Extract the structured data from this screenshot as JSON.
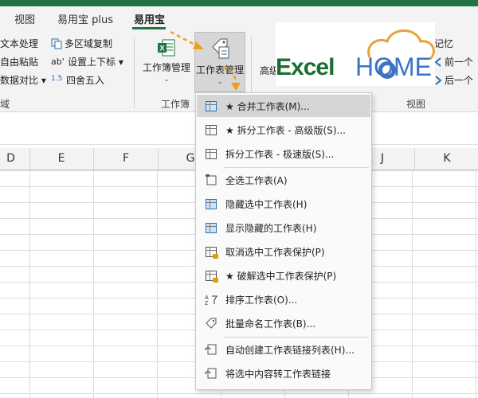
{
  "tabs": [
    {
      "label": "视图"
    },
    {
      "label": "易用宝 plus"
    },
    {
      "label": "易用宝",
      "active": true
    }
  ],
  "ribbon": {
    "left_group": {
      "items": [
        "文本处理",
        "自由粘贴",
        "数据对比 ▾"
      ],
      "label": "域"
    },
    "mid_small": {
      "items": [
        "多区域复制",
        "设置上下标 ▾",
        "四舍五入"
      ]
    },
    "workbook_btn": {
      "label": "工作簿管理",
      "caret": "⌄"
    },
    "sheet_btn": {
      "label": "工作表管理",
      "caret": "⌄"
    },
    "group_label_workbook": "工作簿",
    "partial_btn": "高级",
    "right_items": [
      "记忆",
      "前一个",
      "后一个"
    ],
    "view_group_label": "视图"
  },
  "logo": {
    "part1": "Excel",
    "part2": "HOME"
  },
  "columns": [
    "D",
    "E",
    "F",
    "G",
    "J",
    "K"
  ],
  "menu": {
    "items": [
      {
        "label": "★ 合并工作表(M)...",
        "icon": "merge-sheet-icon",
        "hover": true
      },
      {
        "label": "★ 拆分工作表 - 高级版(S)...",
        "icon": "split-sheet-icon"
      },
      {
        "label": "拆分工作表 - 极速版(S)...",
        "icon": "split-sheet-fast-icon"
      },
      {
        "label": "全选工作表(A)",
        "icon": "select-all-sheets-icon"
      },
      {
        "label": "隐藏选中工作表(H)",
        "icon": "hide-sheet-icon"
      },
      {
        "label": "显示隐藏的工作表(H)",
        "icon": "show-hidden-sheet-icon"
      },
      {
        "label": "取消选中工作表保护(P)",
        "icon": "unprotect-sheet-icon"
      },
      {
        "label": "★ 破解选中工作表保护(P)",
        "icon": "crack-protection-icon"
      },
      {
        "label": "排序工作表(O)...",
        "icon": "sort-sheets-icon"
      },
      {
        "label": "批量命名工作表(B)...",
        "icon": "rename-sheets-icon"
      },
      {
        "label": "自动创建工作表链接列表(H)...",
        "icon": "create-links-icon"
      },
      {
        "label": "将选中内容转工作表链接",
        "icon": "convert-links-icon"
      }
    ]
  },
  "colors": {
    "excel_green": "#217346",
    "logo_green": "#1b6e33",
    "logo_blue": "#3b74c4",
    "arrow_orange": "#f0a020"
  }
}
